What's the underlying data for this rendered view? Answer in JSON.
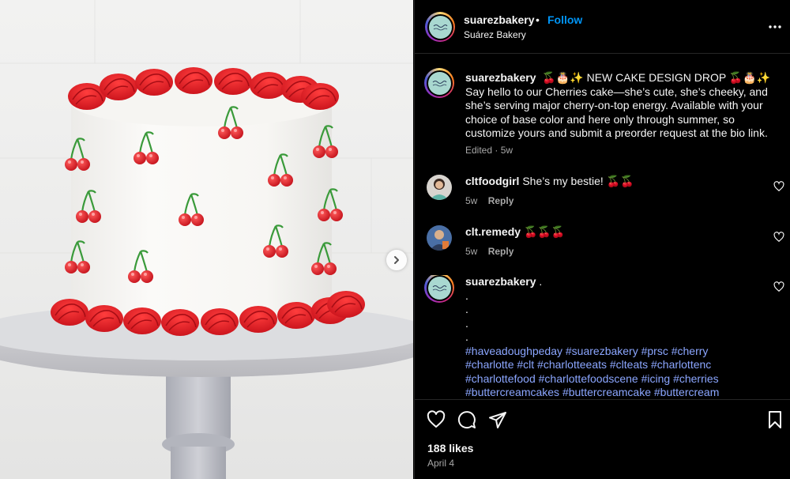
{
  "post": {
    "username": "suarezbakery",
    "follow_label": "Follow",
    "separator": "•",
    "subtitle": "Suárez Bakery",
    "avatar_logo_text": "Have a doughpe day",
    "caption": {
      "username": "suarezbakery",
      "text": "🍒🎂✨ NEW CAKE DESIGN DROP 🍒🎂✨ Say hello to our Cherries cake—she’s cute, she’s cheeky, and she’s serving major cherry-on-top energy. Available with your choice of base color and here only through summer, so customize yours and submit a preorder request at the bio link.",
      "meta": "Edited · 5w"
    },
    "comments": [
      {
        "username": "cltfoodgirl",
        "text": "She’s my bestie! 🍒🍒",
        "time": "5w",
        "reply_label": "Reply"
      },
      {
        "username": "clt.remedy",
        "text": "🍒🍒🍒",
        "time": "5w",
        "reply_label": "Reply"
      }
    ],
    "author_comment": {
      "username": "suarezbakery",
      "text": ".",
      "dots": [
        ".",
        ".",
        ".",
        "."
      ],
      "hashtags": [
        "#haveadoughpeday #suarezbakery #prsc #cherry",
        "#charlotte #clt #charlotteeats #clteats #charlottenc",
        "#charlottefood #charlottefoodscene #icing #cherries",
        "#buttercreamcakes #buttercreamcake #buttercream"
      ]
    },
    "likes": "188 likes",
    "date": "April 4"
  },
  "icons": {
    "more": "more-options-icon",
    "heart": "heart-icon",
    "comment": "comment-icon",
    "share": "send-icon",
    "save": "bookmark-icon",
    "next": "chevron-right-icon"
  },
  "colors": {
    "follow": "#0095f6",
    "background": "#000000",
    "secondary_text": "#a8a8a8",
    "hashtag": "#8ba6ff",
    "frosting_red": "#e8202a",
    "cake_white": "#f7f6f4"
  }
}
